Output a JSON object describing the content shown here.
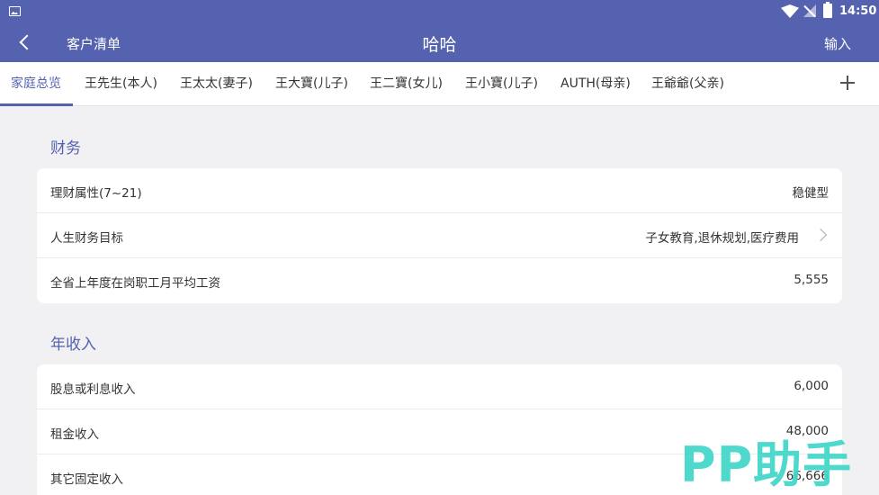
{
  "status": {
    "time": "14:50"
  },
  "nav": {
    "back_label": "客户清单",
    "title": "哈哈",
    "action": "输入"
  },
  "tabs": [
    {
      "label": "家庭总览"
    },
    {
      "label": "王先生(本人)"
    },
    {
      "label": "王太太(妻子)"
    },
    {
      "label": "王大寶(儿子)"
    },
    {
      "label": "王二寶(女儿)"
    },
    {
      "label": "王小寶(儿子)"
    },
    {
      "label": "AUTH(母亲)"
    },
    {
      "label": "王爺爺(父亲)"
    }
  ],
  "finance": {
    "title": "财务",
    "rows": [
      {
        "label": "理财属性(7~21)",
        "value": "稳健型"
      },
      {
        "label": "人生财务目标",
        "value": "子女教育,退休规划,医疗费用"
      },
      {
        "label": "全省上年度在岗职工月平均工资",
        "value": "5,555"
      }
    ]
  },
  "income": {
    "title": "年收入",
    "rows": [
      {
        "label": "股息或利息收入",
        "value": "6,000"
      },
      {
        "label": "租金收入",
        "value": "48,000"
      },
      {
        "label": "其它固定收入",
        "value": "66,666"
      }
    ]
  },
  "watermark": "PP助手"
}
